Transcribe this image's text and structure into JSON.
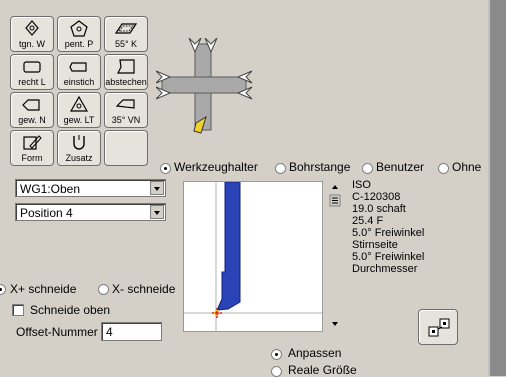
{
  "toolbar": {
    "buttons": [
      {
        "label": "tgn. W",
        "icon": "diamond-insert-icon"
      },
      {
        "label": "pent. P",
        "icon": "pentagon-insert-icon"
      },
      {
        "label": "55° K",
        "icon": "rhombus-55-icon"
      },
      {
        "label": "recht L",
        "icon": "rect-insert-icon"
      },
      {
        "label": "einstich",
        "icon": "groove-insert-icon"
      },
      {
        "label": "abstechen",
        "icon": "partoff-insert-icon"
      },
      {
        "label": "gew. N",
        "icon": "thread-n-icon"
      },
      {
        "label": "gew. LT",
        "icon": "thread-lt-icon"
      },
      {
        "label": "35° VN",
        "icon": "rhombus-35-icon"
      },
      {
        "label": "Form",
        "icon": "form-edit-icon"
      },
      {
        "label": "Zusatz",
        "icon": "magnet-icon"
      },
      {
        "label": "",
        "icon": ""
      }
    ]
  },
  "holder_type": {
    "options": [
      "Werkzeughalter",
      "Bohrstange",
      "Benutzer",
      "Ohne"
    ],
    "selected": "Werkzeughalter"
  },
  "dropdowns": {
    "group": "WG1:Oben",
    "position": "Position 4"
  },
  "edge": {
    "options": [
      "X+ schneide",
      "X- schneide"
    ],
    "selected": "X+ schneide",
    "top_edge_label": "Schneide oben",
    "top_edge_checked": false
  },
  "offset": {
    "label": "Offset-Nummer",
    "value": "4"
  },
  "info": {
    "lines": [
      "ISO",
      "C-120308",
      "19.0 schaft",
      "25.4 F",
      "5.0° Freiwinkel",
      "Stirnseite",
      "5.0° Freiwinkel",
      "Durchmesser"
    ]
  },
  "view": {
    "options": [
      "Anpassen",
      "Reale Größe"
    ],
    "selected": "Anpassen"
  },
  "colors": {
    "tool_blue": "#2a44b8",
    "insert_yellow": "#f1d22a",
    "origin_red": "#e02020"
  }
}
